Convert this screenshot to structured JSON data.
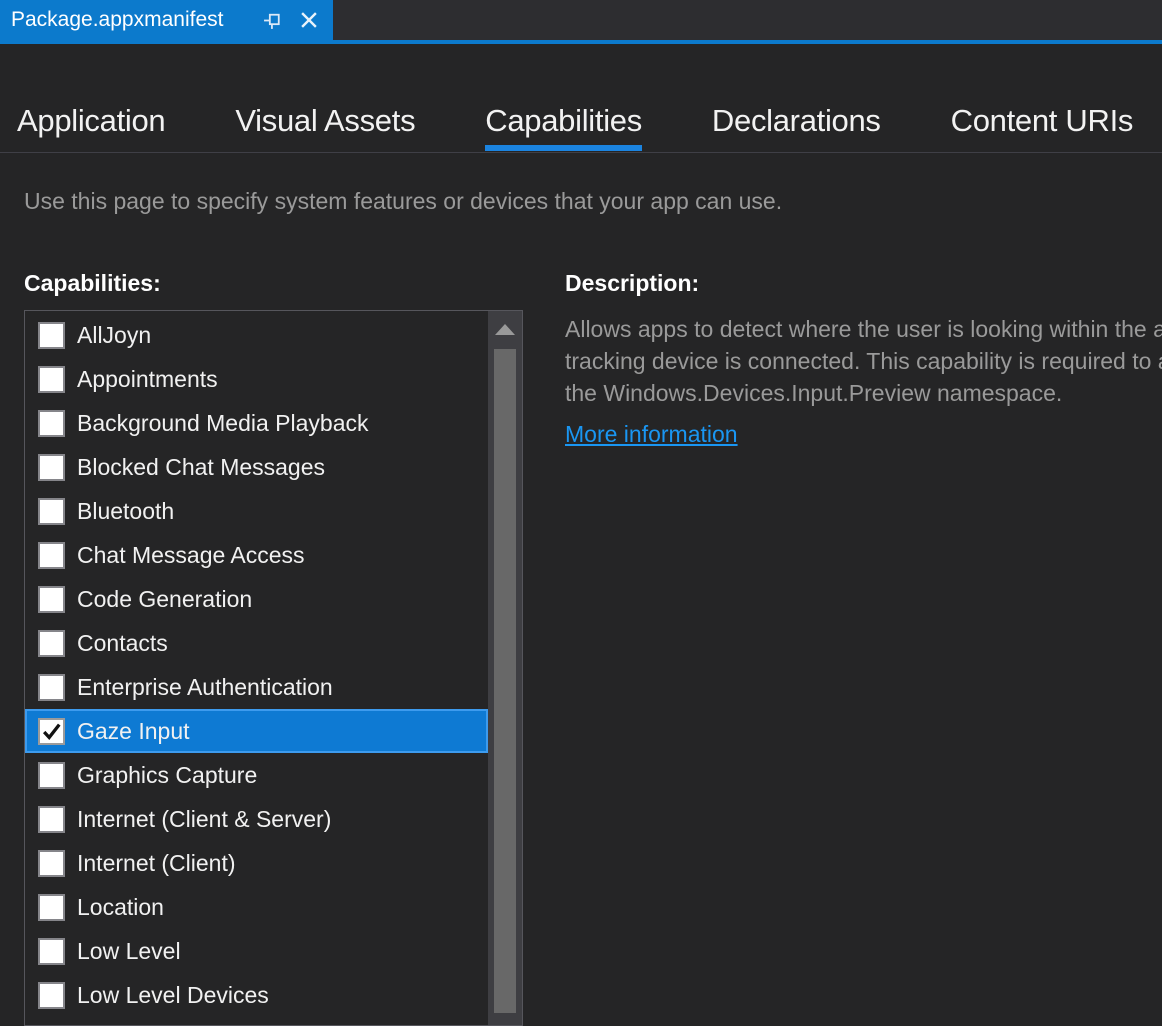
{
  "colors": {
    "accent_blue": "#0c7acc",
    "active_tab_underline": "#1b84e0",
    "selected_row_bg": "#0e7ad3",
    "selected_row_border": "#3d9bee",
    "link_blue": "#1a96f2",
    "page_bg": "#252526",
    "muted_text": "#9a9a9a"
  },
  "editor_tab": {
    "title": "Package.appxmanifest"
  },
  "nav": {
    "tabs": [
      {
        "label": "Application",
        "active": false
      },
      {
        "label": "Visual Assets",
        "active": false
      },
      {
        "label": "Capabilities",
        "active": true
      },
      {
        "label": "Declarations",
        "active": false
      },
      {
        "label": "Content URIs",
        "active": false
      }
    ]
  },
  "intro": "Use this page to specify system features or devices that your app can use.",
  "capabilities": {
    "label": "Capabilities:",
    "items": [
      {
        "label": "AllJoyn",
        "checked": false,
        "selected": false
      },
      {
        "label": "Appointments",
        "checked": false,
        "selected": false
      },
      {
        "label": "Background Media Playback",
        "checked": false,
        "selected": false
      },
      {
        "label": "Blocked Chat Messages",
        "checked": false,
        "selected": false
      },
      {
        "label": "Bluetooth",
        "checked": false,
        "selected": false
      },
      {
        "label": "Chat Message Access",
        "checked": false,
        "selected": false
      },
      {
        "label": "Code Generation",
        "checked": false,
        "selected": false
      },
      {
        "label": "Contacts",
        "checked": false,
        "selected": false
      },
      {
        "label": "Enterprise Authentication",
        "checked": false,
        "selected": false
      },
      {
        "label": "Gaze Input",
        "checked": true,
        "selected": true
      },
      {
        "label": "Graphics Capture",
        "checked": false,
        "selected": false
      },
      {
        "label": "Internet (Client & Server)",
        "checked": false,
        "selected": false
      },
      {
        "label": "Internet (Client)",
        "checked": false,
        "selected": false
      },
      {
        "label": "Location",
        "checked": false,
        "selected": false
      },
      {
        "label": "Low Level",
        "checked": false,
        "selected": false
      },
      {
        "label": "Low Level Devices",
        "checked": false,
        "selected": false
      }
    ]
  },
  "description": {
    "label": "Description:",
    "lines": [
      "Allows apps to detect where the user is looking within the app when a compatible eye-",
      "tracking device is connected. This capability is required to access eye gaze data using APIs in",
      "the Windows.Devices.Input.Preview namespace."
    ],
    "link": "More information"
  }
}
